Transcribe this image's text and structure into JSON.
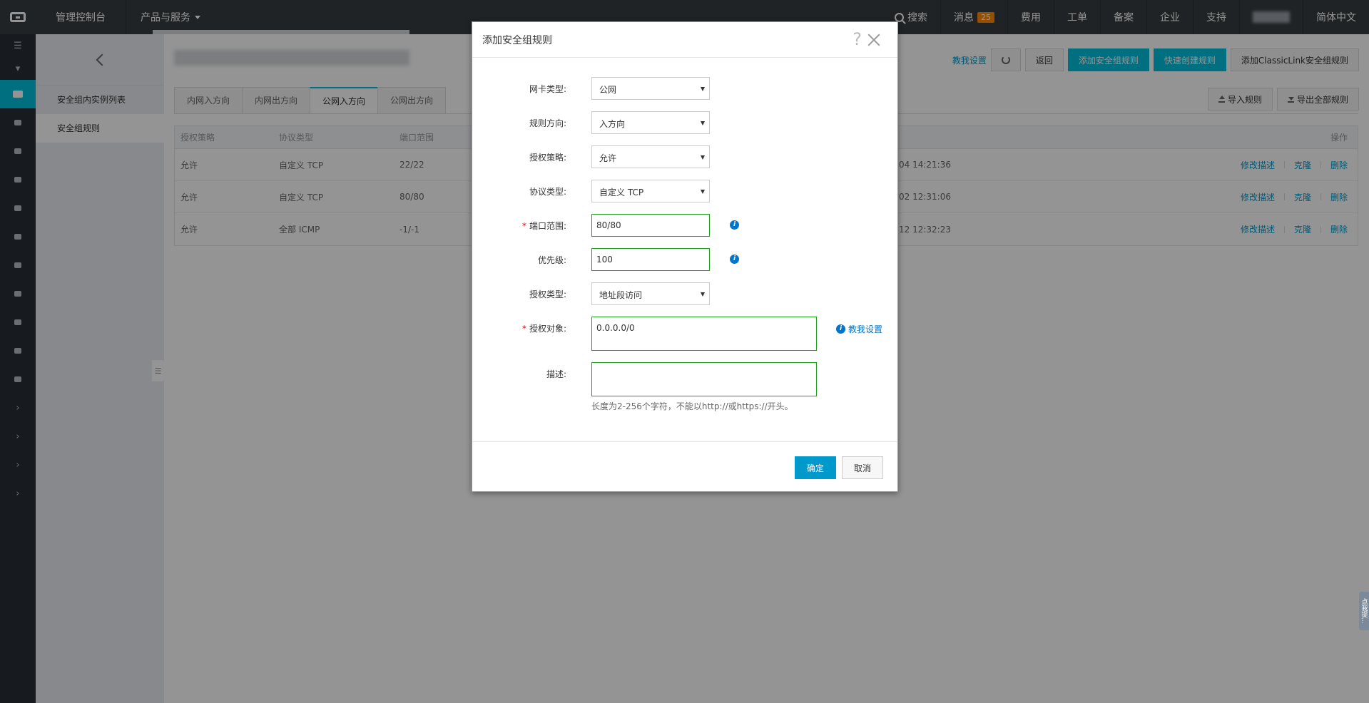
{
  "topbar": {
    "console": "管理控制台",
    "products": "产品与服务",
    "search": "搜索",
    "messages": "消息",
    "messages_count": "25",
    "fees": "费用",
    "tickets": "工单",
    "filing": "备案",
    "enterprise": "企业",
    "support": "支持",
    "language": "简体中文"
  },
  "subnav": {
    "items": [
      {
        "label": "安全组内实例列表"
      },
      {
        "label": "安全组规则"
      }
    ]
  },
  "actions": {
    "help_link": "教我设置",
    "back": "返回",
    "add_rule": "添加安全组规则",
    "quick_create": "快速创建规则",
    "add_classiclink": "添加ClassicLink安全组规则"
  },
  "tabs": [
    {
      "label": "内网入方向"
    },
    {
      "label": "内网出方向"
    },
    {
      "label": "公网入方向"
    },
    {
      "label": "公网出方向"
    }
  ],
  "tools": {
    "import": "导入规则",
    "export": "导出全部规则"
  },
  "table": {
    "headers": [
      "授权策略",
      "协议类型",
      "端口范围",
      "操作"
    ],
    "rows": [
      {
        "policy": "允许",
        "protocol": "自定义 TCP",
        "port": "22/22",
        "time": "04 14:21:36"
      },
      {
        "policy": "允许",
        "protocol": "自定义 TCP",
        "port": "80/80",
        "time": "02 12:31:06"
      },
      {
        "policy": "允许",
        "protocol": "全部 ICMP",
        "port": "-1/-1",
        "time": "12 12:32:23"
      }
    ],
    "ops": {
      "edit": "修改描述",
      "clone": "克隆",
      "delete": "删除"
    }
  },
  "modal": {
    "title": "添加安全组规则",
    "help": "?",
    "fields": {
      "nic_type": {
        "label": "网卡类型:",
        "value": "公网"
      },
      "direction": {
        "label": "规则方向:",
        "value": "入方向"
      },
      "policy": {
        "label": "授权策略:",
        "value": "允许"
      },
      "protocol": {
        "label": "协议类型:",
        "value": "自定义 TCP"
      },
      "port": {
        "label": "端口范围:",
        "value": "80/80"
      },
      "priority": {
        "label": "优先级:",
        "value": "100"
      },
      "auth_type": {
        "label": "授权类型:",
        "value": "地址段访问"
      },
      "auth_object": {
        "label": "授权对象:",
        "value": "0.0.0.0/0"
      },
      "description": {
        "label": "描述:",
        "value": ""
      }
    },
    "help_link": "教我设置",
    "hint": "长度为2-256个字符，不能以http://或https://开头。",
    "ok": "确定",
    "cancel": "取消"
  },
  "feedback": "点我提..."
}
